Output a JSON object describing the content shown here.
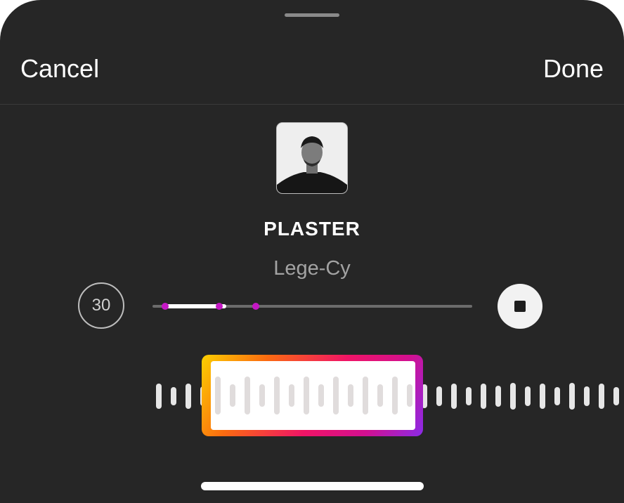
{
  "header": {
    "cancel_label": "Cancel",
    "done_label": "Done"
  },
  "track": {
    "title": "PLASTER",
    "artist": "Lege-Cy"
  },
  "player": {
    "duration_seconds": "30",
    "progress_fraction": 0.2,
    "stop_icon": "stop-icon"
  },
  "colors": {
    "background": "#262626",
    "accent_marker": "#c417c4",
    "gradient": [
      "#fcd000",
      "#fb6b10",
      "#f01466",
      "#d21090",
      "#8a2be8"
    ]
  }
}
